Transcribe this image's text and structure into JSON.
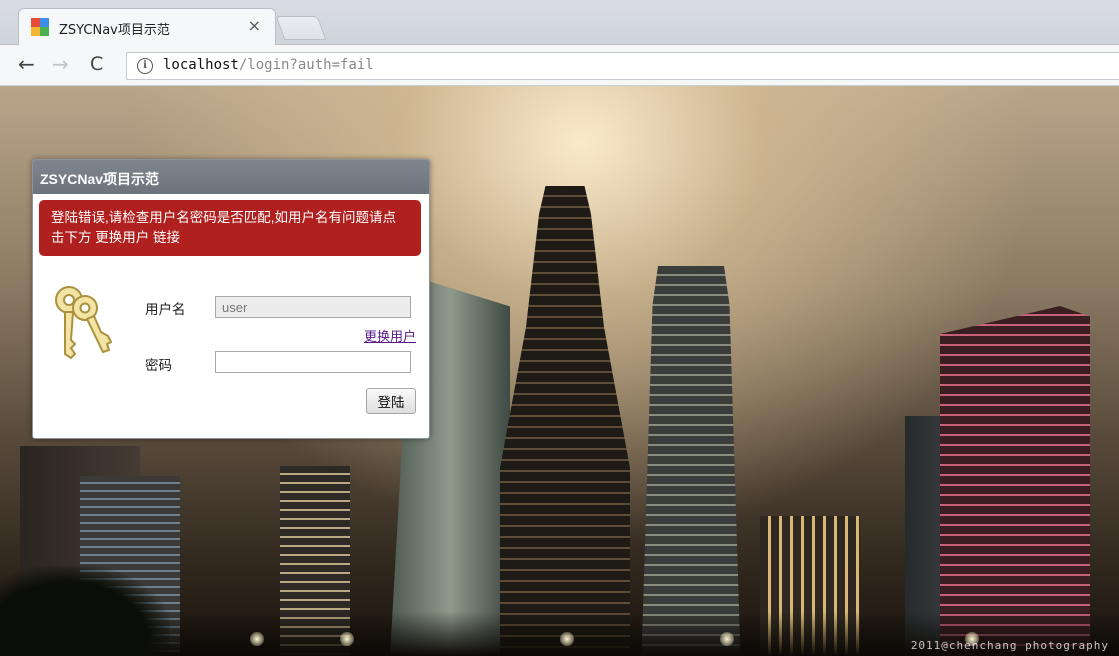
{
  "browser": {
    "tab": {
      "title": "ZSYCNav项目示范",
      "favicon": "app-favicon",
      "close_glyph": "×"
    },
    "nav": {
      "back_glyph": "←",
      "forward_glyph": "→",
      "reload_glyph": "C"
    },
    "address": {
      "host": "localhost",
      "path": "/login?auth=fail",
      "info_glyph": "i"
    }
  },
  "login": {
    "title": "ZSYCNav项目示范",
    "error_message": "登陆错误,请检查用户名密码是否匹配,如用户名有问题请点击下方 更换用户 链接",
    "username_label": "用户名",
    "username_value": "user",
    "switch_user_link": "更换用户",
    "password_label": "密码",
    "password_value": "",
    "submit_label": "登陆",
    "icon": "keys-icon"
  },
  "background": {
    "watermark": "2011@chenchang photography"
  },
  "colors": {
    "alert_bg": "#b0201e",
    "panel_header": "#737982",
    "link": "#551a8b"
  }
}
